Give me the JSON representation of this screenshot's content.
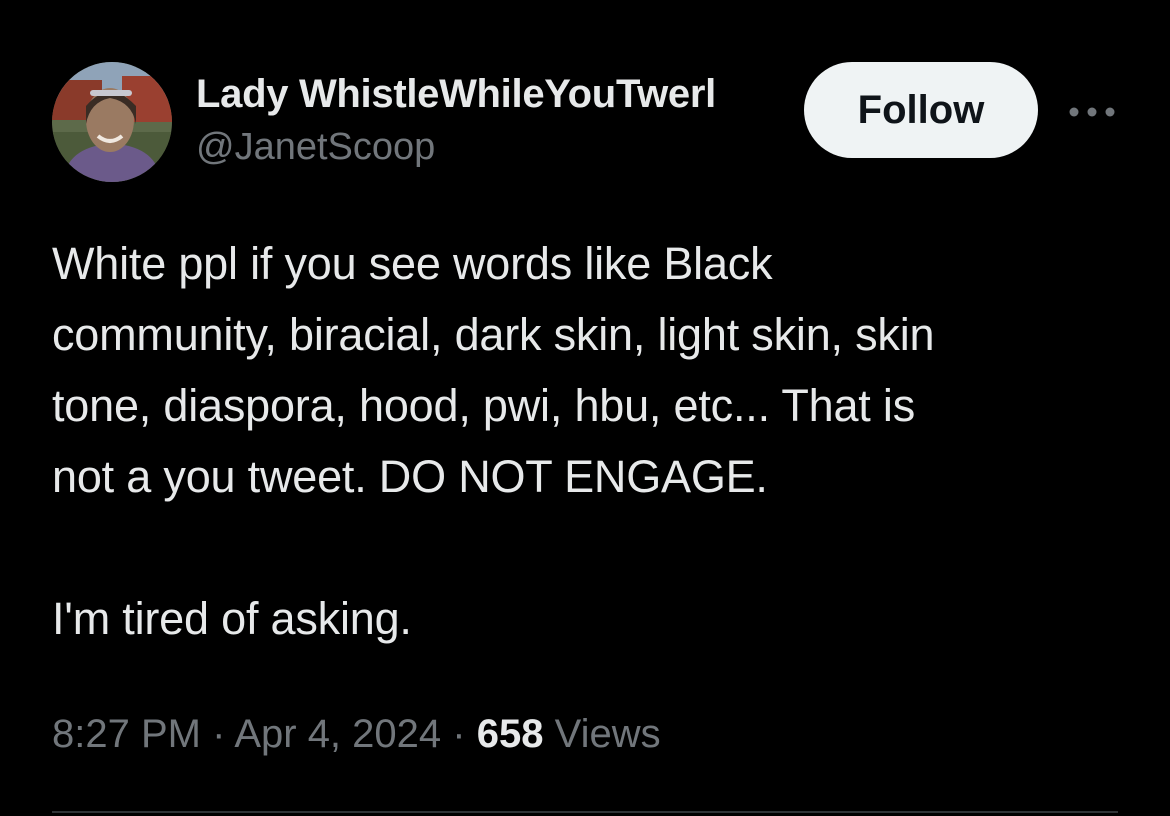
{
  "tweet": {
    "author": {
      "display_name": "Lady WhistleWhileYouTwerl",
      "handle": "@JanetScoop",
      "avatar_icon": "profile-photo"
    },
    "follow_label": "Follow",
    "more_icon": "more-horizontal-icon",
    "text": "White ppl if you see words like Black\ncommunity, biracial, dark skin, light skin, skin\ntone, diaspora, hood, pwi, hbu, etc... That is\nnot a you tweet. DO NOT ENGAGE.\n\nI'm tired of asking.",
    "time": "8:27 PM",
    "separator": "·",
    "date": "Apr 4, 2024",
    "views_count": "658",
    "views_label": "Views"
  },
  "colors": {
    "background": "#000000",
    "primary_text": "#e7e9ea",
    "secondary_text": "#71767b",
    "follow_button_bg": "#eff3f4",
    "follow_button_text": "#0f1419",
    "divider": "#2f3336"
  }
}
